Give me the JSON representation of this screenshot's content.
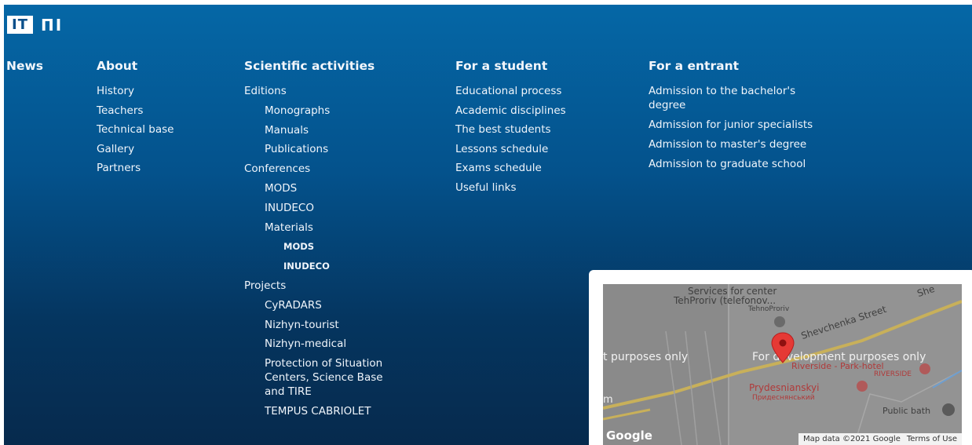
{
  "logo": {
    "box_text": "IT",
    "text": "ПІ"
  },
  "news_label": "News",
  "about": {
    "title": "About",
    "items": [
      "History",
      "Teachers",
      "Technical base",
      "Gallery",
      "Partners"
    ]
  },
  "science": {
    "title": "Scientific activities",
    "items": [
      {
        "label": "Editions",
        "level": 0
      },
      {
        "label": "Monographs",
        "level": 1
      },
      {
        "label": "Manuals",
        "level": 1
      },
      {
        "label": "Publications",
        "level": 1
      },
      {
        "label": "Conferences",
        "level": 0
      },
      {
        "label": "MODS",
        "level": 1
      },
      {
        "label": "INUDECO",
        "level": 1
      },
      {
        "label": "Materials",
        "level": 1
      },
      {
        "label": "MODS",
        "level": 2
      },
      {
        "label": "INUDECO",
        "level": 2
      },
      {
        "label": "Projects",
        "level": 0
      },
      {
        "label": "CyRADARS",
        "level": 1
      },
      {
        "label": "Nizhyn-tourist",
        "level": 1
      },
      {
        "label": "Nizhyn-medical",
        "level": 1
      },
      {
        "label": "Protection of Situation Centers, Science Base and TIRE",
        "level": 1
      },
      {
        "label": "TEMPUS CABRIOLET",
        "level": 1
      }
    ]
  },
  "student": {
    "title": "For a student",
    "items": [
      "Educational process",
      "Academic disciplines",
      "The best students",
      "Lessons schedule",
      "Exams schedule",
      "Useful links"
    ]
  },
  "entrant": {
    "title": "For a entrant",
    "items": [
      "Admission to the bachelor's degree",
      "Admission for junior specialists",
      "Admission to master's degree",
      "Admission to graduate school"
    ]
  },
  "map": {
    "labels": [
      "Services for center",
      "TehProriv (telefonov...",
      "TehnoProriv",
      "Shevchenka Street",
      "She",
      "Riverside - Park-hotel",
      "RIVERSIDE",
      "Prydesnianskyi",
      "Придеснянський",
      "Public bath"
    ],
    "watermark_left": "t purposes only",
    "watermark_right": "For development purposes only",
    "google_logo": "Google",
    "data_credit": "Map data ©2021 Google",
    "terms": "Terms of Use",
    "edge_letter": "m"
  },
  "colors": {
    "bg_top": "#0567a6",
    "bg_bottom": "#062a4d",
    "pin": "#e53935"
  }
}
